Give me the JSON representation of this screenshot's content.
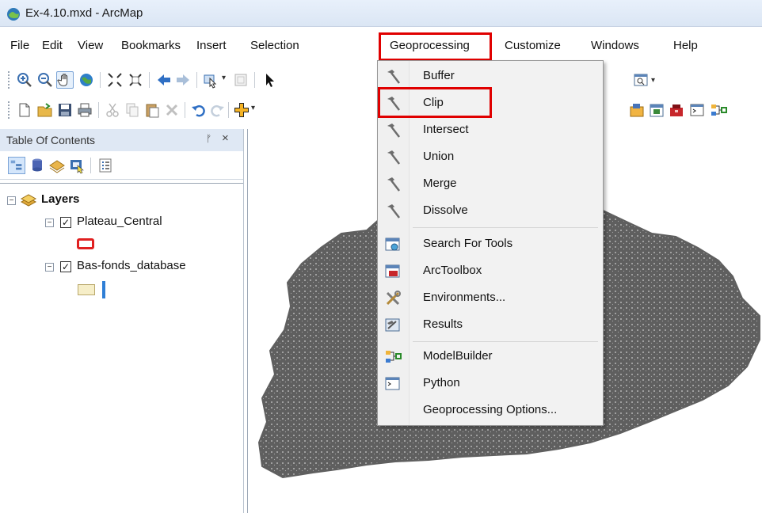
{
  "window": {
    "title": "Ex-4.10.mxd - ArcMap"
  },
  "menubar": {
    "items": [
      "File",
      "Edit",
      "View",
      "Bookmarks",
      "Insert",
      "Selection",
      "Geoprocessing",
      "Customize",
      "Windows",
      "Help"
    ],
    "active": "Geoprocessing",
    "highlight_color": "#e00000"
  },
  "geoprocessing_menu": {
    "items": [
      {
        "label": "Buffer",
        "icon": "hammer-icon"
      },
      {
        "label": "Clip",
        "icon": "hammer-icon",
        "highlighted": true
      },
      {
        "label": "Intersect",
        "icon": "hammer-icon"
      },
      {
        "label": "Union",
        "icon": "hammer-icon"
      },
      {
        "label": "Merge",
        "icon": "hammer-icon"
      },
      {
        "label": "Dissolve",
        "icon": "hammer-icon"
      },
      {
        "label": "Search For Tools",
        "icon": "search-tools-icon"
      },
      {
        "label": "ArcToolbox",
        "icon": "toolbox-icon"
      },
      {
        "label": "Environments...",
        "icon": "environments-icon"
      },
      {
        "label": "Results",
        "icon": "results-icon"
      },
      {
        "label": "ModelBuilder",
        "icon": "modelbuilder-icon"
      },
      {
        "label": "Python",
        "icon": "python-window-icon"
      },
      {
        "label": "Geoprocessing Options...",
        "icon": ""
      }
    ]
  },
  "toc": {
    "title": "Table Of Contents",
    "pin_symbol": "ᚠ",
    "close_symbol": "×",
    "root": {
      "label": "Layers",
      "expanded": true
    },
    "layers": [
      {
        "name": "Plateau_Central",
        "visible": true,
        "symbol": "hollow-red-polygon",
        "symbol_color": "#e02020"
      },
      {
        "name": "Bas-fonds_database",
        "visible": true,
        "symbol": "tan-polygon",
        "symbol_color": "#f6eec8"
      }
    ]
  },
  "map": {
    "feature_color": "#5f5f5f"
  }
}
